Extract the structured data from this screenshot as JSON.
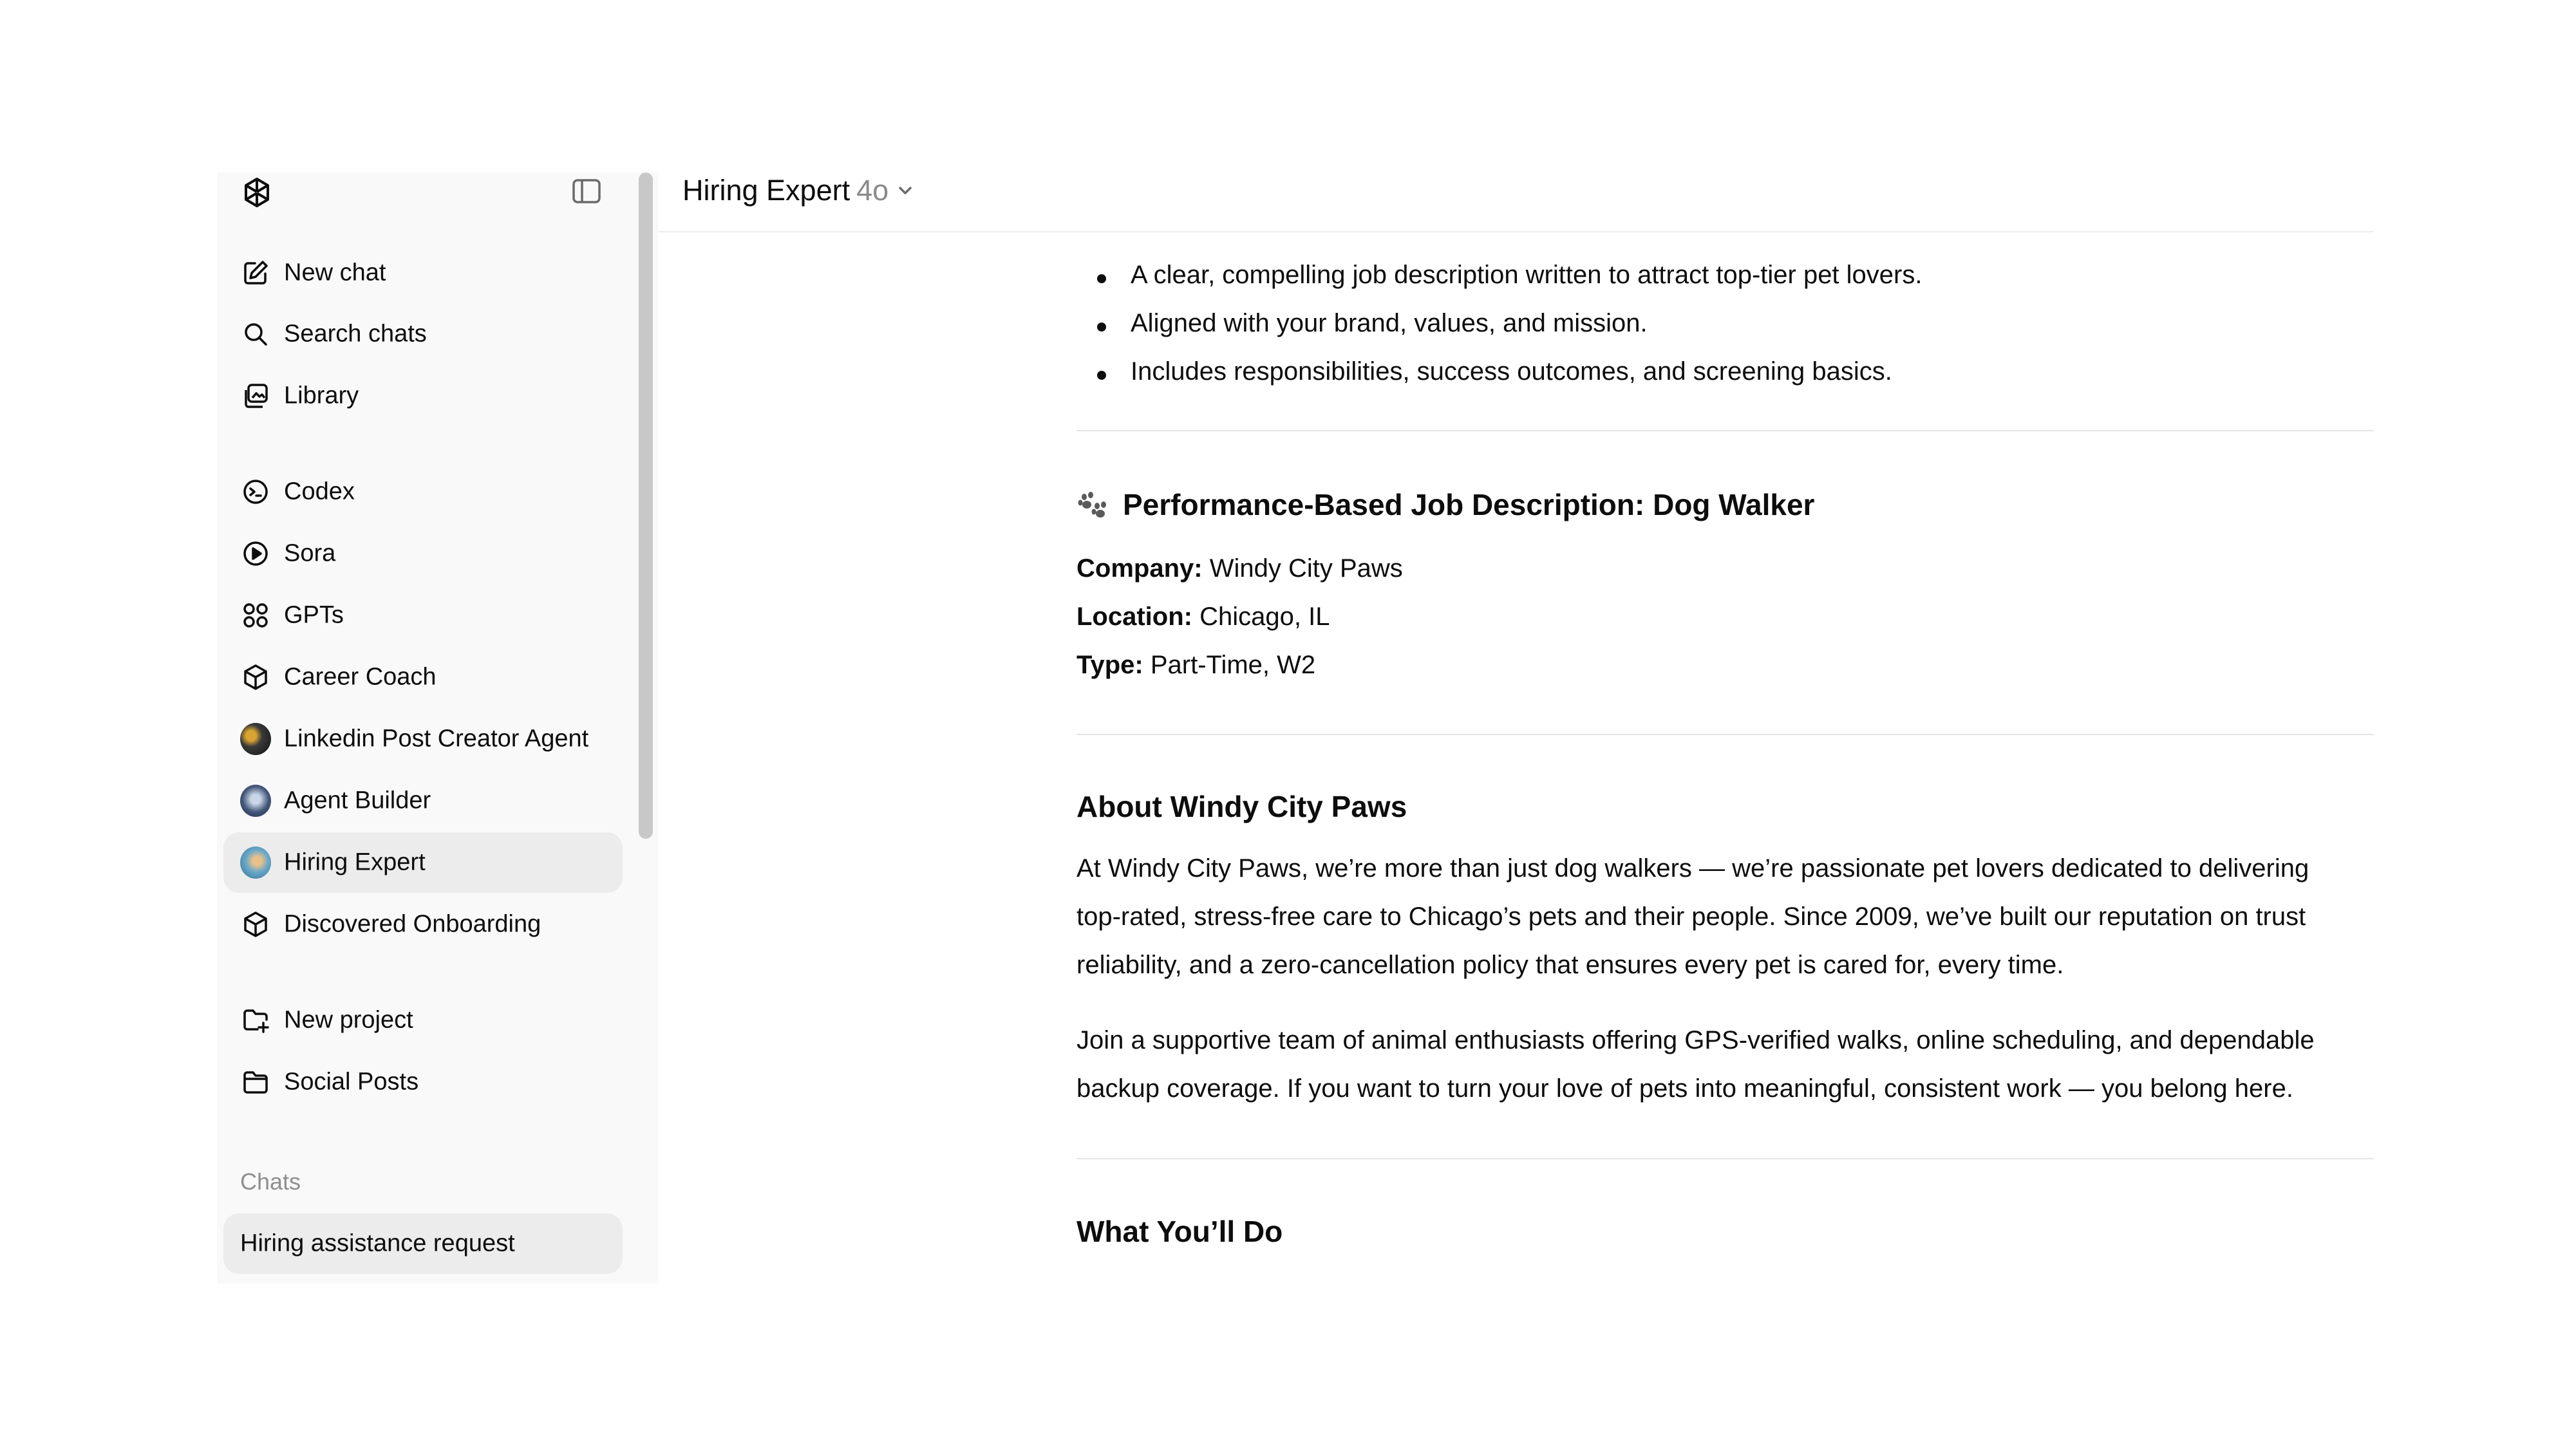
{
  "sidebar": {
    "items": [
      {
        "label": "New chat",
        "icon": "compose-icon"
      },
      {
        "label": "Search chats",
        "icon": "search-icon"
      },
      {
        "label": "Library",
        "icon": "library-icon"
      }
    ],
    "tools": [
      {
        "label": "Codex",
        "icon": "codex-icon"
      },
      {
        "label": "Sora",
        "icon": "play-circle-icon"
      },
      {
        "label": "GPTs",
        "icon": "grid-icon"
      },
      {
        "label": "Career Coach",
        "icon": "cube-icon"
      },
      {
        "label": "Linkedin Post Creator Agent",
        "icon": "avatar"
      },
      {
        "label": "Agent Builder",
        "icon": "avatar"
      },
      {
        "label": "Hiring Expert",
        "icon": "avatar"
      },
      {
        "label": "Discovered Onboarding",
        "icon": "cube-icon"
      }
    ],
    "projects": [
      {
        "label": "New project",
        "icon": "folder-plus-icon"
      },
      {
        "label": "Social Posts",
        "icon": "folder-icon"
      }
    ],
    "chats_heading": "Chats",
    "chats": [
      {
        "label": "Hiring assistance request"
      }
    ]
  },
  "header": {
    "model_name": "Hiring Expert",
    "model_version": "4o"
  },
  "message": {
    "bullets": [
      "A clear, compelling job description written to attract top-tier pet lovers.",
      "Aligned with your brand, values, and mission.",
      "Includes responsibilities, success outcomes, and screening basics."
    ],
    "title": "Performance-Based Job Description: Dog Walker",
    "details": [
      {
        "key": "Company:",
        "value": " Windy City Paws"
      },
      {
        "key": "Location:",
        "value": " Chicago, IL"
      },
      {
        "key": "Type:",
        "value": " Part-Time, W2"
      }
    ],
    "about_heading": "About Windy City Paws",
    "about_p1_lines": [
      "At Windy City Paws, we’re more than just dog walkers — we’re passionate pet lovers dedicated to delivering",
      "top-rated, stress-free care to Chicago’s pets and their people. Since 2009, we’ve built our reputation on trust",
      "reliability, and a zero-cancellation policy that ensures every pet is cared for, every time."
    ],
    "about_p2_lines": [
      "Join a supportive team of animal enthusiasts offering GPS-verified walks, online scheduling, and dependable",
      "backup coverage. If you want to turn your love of pets into meaningful, consistent work — you belong here."
    ],
    "what_heading": "What You’ll Do"
  },
  "colors": {
    "sidebar_bg": "#f9f9f9",
    "active_item_bg": "#ececec",
    "text": "#0d0d0d",
    "muted": "#8a8a8a"
  }
}
